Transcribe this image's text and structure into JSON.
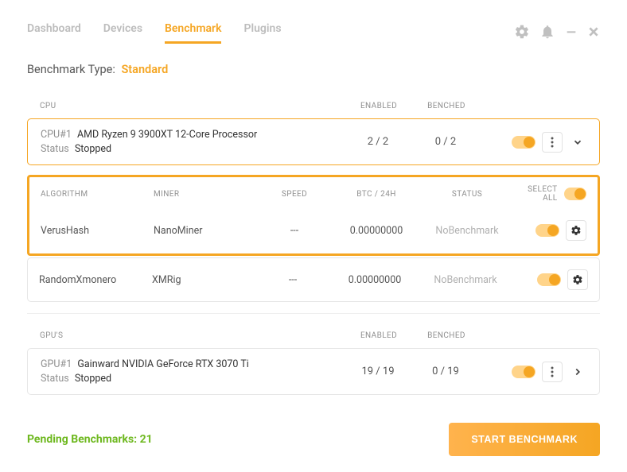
{
  "nav": {
    "tabs": [
      "Dashboard",
      "Devices",
      "Benchmark",
      "Plugins"
    ],
    "active": "Benchmark"
  },
  "benchmark_type": {
    "label": "Benchmark Type:",
    "value": "Standard"
  },
  "cpu_section": {
    "header": {
      "label": "CPU",
      "enabled": "ENABLED",
      "benched": "BENCHED"
    },
    "device": {
      "id": "CPU#1",
      "name": "AMD Ryzen 9 3900XT 12-Core Processor",
      "status_label": "Status",
      "status": "Stopped",
      "enabled": "2 / 2",
      "benched": "0 / 2"
    },
    "algo_header": {
      "algorithm": "ALGORITHM",
      "miner": "MINER",
      "speed": "SPEED",
      "btc": "BTC / 24H",
      "status": "STATUS",
      "select_all": "SELECT ALL"
    },
    "algorithms": [
      {
        "algorithm": "VerusHash",
        "miner": "NanoMiner",
        "speed": "---",
        "btc": "0.00000000",
        "status": "NoBenchmark"
      },
      {
        "algorithm": "RandomXmonero",
        "miner": "XMRig",
        "speed": "---",
        "btc": "0.00000000",
        "status": "NoBenchmark"
      }
    ]
  },
  "gpu_section": {
    "header": {
      "label": "GPU'S",
      "enabled": "ENABLED",
      "benched": "BENCHED"
    },
    "device": {
      "id": "GPU#1",
      "name": "Gainward NVIDIA GeForce RTX 3070 Ti",
      "status_label": "Status",
      "status": "Stopped",
      "enabled": "19 / 19",
      "benched": "0 / 19"
    }
  },
  "footer": {
    "pending": "Pending Benchmarks: 21",
    "start": "START BENCHMARK"
  }
}
